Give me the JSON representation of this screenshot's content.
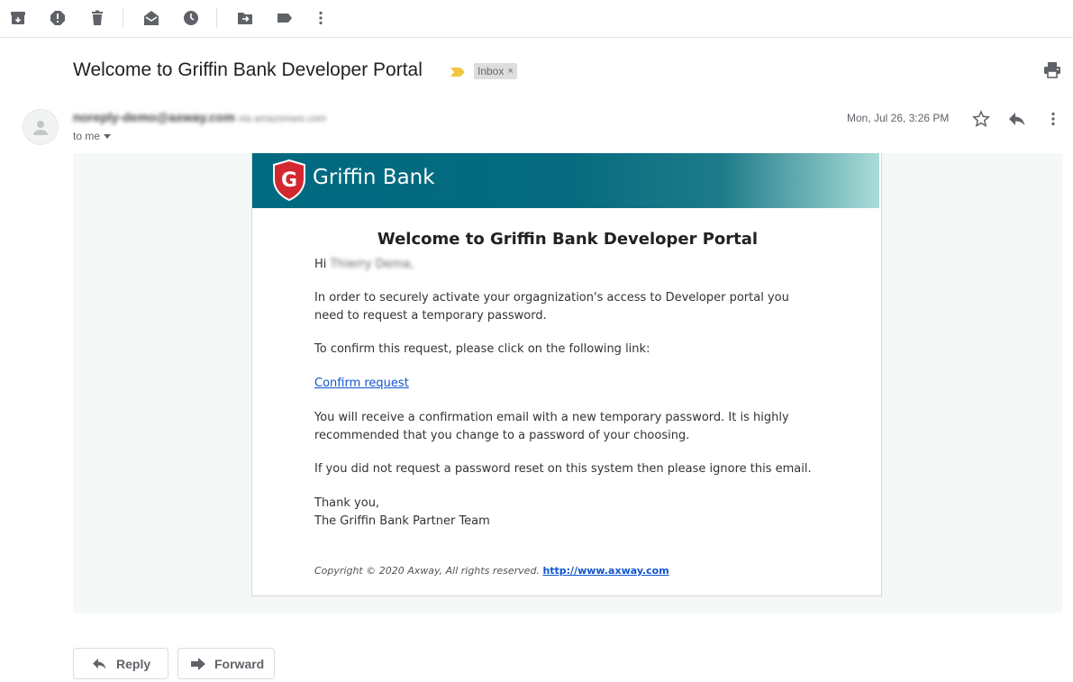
{
  "toolbar": {
    "icons": [
      "archive-icon",
      "report-spam-icon",
      "delete-icon",
      "mark-unread-icon",
      "snooze-icon",
      "move-to-icon",
      "label-icon",
      "more-icon"
    ]
  },
  "message": {
    "subject": "Welcome to Griffin Bank Developer Portal",
    "label_chip": "Inbox",
    "label_remove": "×",
    "sender_name": "noreply-demo@axway.com",
    "sender_via": "via amazonses.com",
    "recipient": "to me",
    "date": "Mon, Jul 26, 3:26 PM"
  },
  "email": {
    "brand": "Griffin Bank",
    "shield_letter": "G",
    "title": "Welcome to Griffin Bank Developer Portal",
    "greeting_prefix": "Hi",
    "greeting_name": "Thierry Dema,",
    "para1_line1": "In order to securely activate your orgagnization's access to Developer portal you",
    "para1_line2": "need to request a temporary password.",
    "para2": "To confirm this request, please click on the following link:",
    "confirm_link": "Confirm request",
    "para3_line1": "You will receive a confirmation email with a new temporary password. It is highly",
    "para3_line2": "recommended that you change to a password of your choosing.",
    "para4": "If you did not request a password reset on this system then please ignore this email.",
    "signoff1": "Thank you,",
    "signoff2": "The Griffin Bank Partner Team",
    "copyright": "Copyright © 2020 Axway, All rights reserved.",
    "copyright_link": "http://www.axway.com"
  },
  "actions": {
    "reply": "Reply",
    "forward": "Forward"
  },
  "colors": {
    "banner": "#006a80",
    "link": "#1155cc",
    "shield_red": "#d3282f",
    "label_marker": "#f4c542"
  }
}
